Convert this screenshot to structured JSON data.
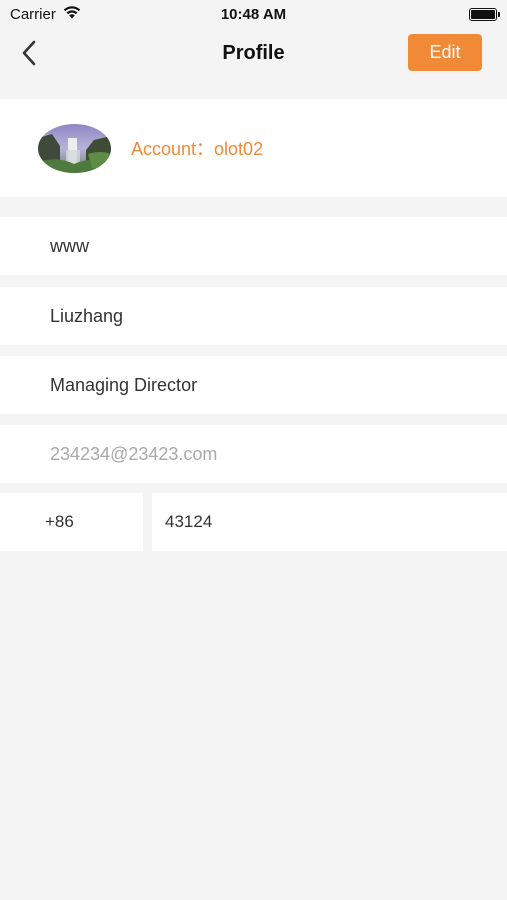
{
  "status_bar": {
    "carrier": "Carrier",
    "time": "10:48 AM",
    "icons": [
      "wifi-icon",
      "battery-icon"
    ]
  },
  "nav": {
    "title": "Profile",
    "edit_label": "Edit",
    "back_icon": "chevron-left-icon"
  },
  "account": {
    "label": "Account：olot02"
  },
  "fields": {
    "field1": "www",
    "field2": "Liuzhang",
    "field3": "Managing Director",
    "email_placeholder": "234234@23423.com",
    "phone_code": "+86",
    "phone_number": "43124"
  },
  "colors": {
    "accent": "#f18a36",
    "background": "#f4f4f4",
    "card": "#ffffff",
    "placeholder": "#a9a9a9"
  }
}
